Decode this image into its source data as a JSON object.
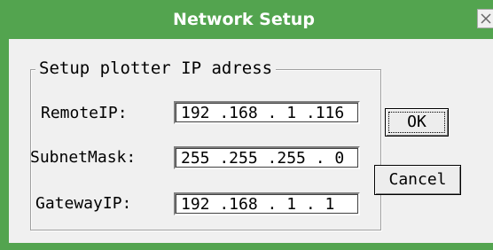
{
  "window": {
    "title": "Network Setup"
  },
  "group": {
    "title": "Setup plotter IP adress"
  },
  "fields": [
    {
      "label": "RemoteIP:",
      "value": "192 .168 . 1 .116"
    },
    {
      "label": "SubnetMask:",
      "value": "255 .255 .255 . 0"
    },
    {
      "label": "GatewayIP:",
      "value": "192 .168 . 1 . 1"
    }
  ],
  "buttons": {
    "ok_label": "OK",
    "cancel_label": "Cancel"
  },
  "colors": {
    "titlebar": "#53a44f",
    "title_text": "#ffffff",
    "background": "#f0f0f0"
  },
  "icons": {
    "close": "close-icon"
  }
}
